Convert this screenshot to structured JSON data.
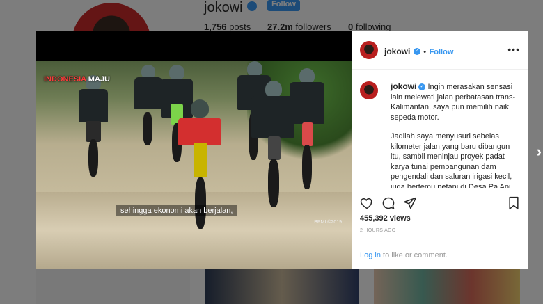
{
  "profile": {
    "username": "jokowi",
    "follow_label": "Follow",
    "posts": "1,756",
    "posts_label": "posts",
    "followers": "27.2m",
    "followers_label": "followers",
    "following": "0",
    "following_label": "following"
  },
  "post": {
    "username": "jokowi",
    "follow_label": "Follow",
    "separator": "•",
    "more_label": "•••",
    "caption_p1": "Ingin merasakan sensasi lain melewati jalan perbatasan trans-Kalimantan, saya pun memilih naik sepeda motor.",
    "caption_p2": "Jadilah saya menyusuri sebelas kilometer jalan yang baru dibangun itu, sambil meninjau proyek padat karya tunai pembangunan dam pengendali dan saluran irigasi kecil, juga bertemu petani di Desa Pa Api.",
    "views": "455,392 views",
    "time": "2 HOURS AGO",
    "login_link": "Log in",
    "login_rest": " to like or comment."
  },
  "video": {
    "watermark_a": "INDONESIA",
    "watermark_b": "MAJU",
    "subtitle": "sehingga ekonomi akan berjalan,",
    "credit": "BPMI ©2019"
  },
  "icons": {
    "verified": "✓",
    "next": "›"
  },
  "colors": {
    "accent": "#3897f0",
    "rider_shirt": "#d32f2f"
  }
}
